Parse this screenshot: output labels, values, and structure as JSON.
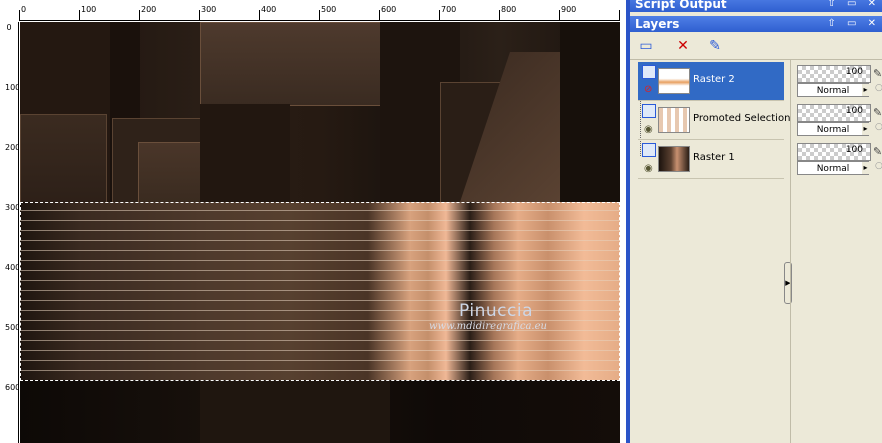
{
  "panels": {
    "script_output_title": "Script Output",
    "layers_title": "Layers",
    "titlebar_icons": "⇧ ▭ ✕"
  },
  "ruler": {
    "top_ticks": [
      "0",
      "100",
      "200",
      "300",
      "400",
      "500",
      "600",
      "700",
      "800",
      "900"
    ],
    "left_ticks": [
      "0",
      "100",
      "200",
      "300",
      "400",
      "500",
      "600"
    ]
  },
  "watermark": {
    "name": "Pinuccia",
    "url": "www.mdidiregrafica.eu"
  },
  "layers": [
    {
      "name": "Raster 2",
      "selected": true,
      "opacity": "100",
      "blend": "Normal"
    },
    {
      "name": "Promoted Selection",
      "selected": false,
      "opacity": "100",
      "blend": "Normal"
    },
    {
      "name": "Raster 1",
      "selected": false,
      "opacity": "100",
      "blend": "Normal"
    }
  ],
  "colors": {
    "accent": "#316ac5",
    "panel_title": "#2f5fd0",
    "band_highlight": "#f0b896",
    "image_dark": "#1c130e"
  },
  "icons": [
    "new-layer-icon",
    "delete-layer-icon",
    "edit-layer-icon",
    "eye-icon",
    "pen-icon",
    "lock-icon"
  ]
}
